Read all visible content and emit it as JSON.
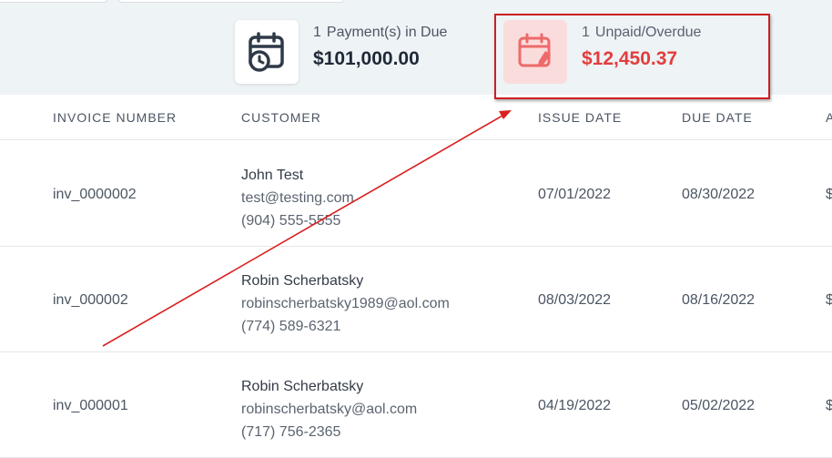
{
  "summary": {
    "due": {
      "count": "1",
      "label": "Payment(s) in Due",
      "amount": "$101,000.00",
      "icon": "calendar-clock-icon"
    },
    "overdue": {
      "count": "1",
      "label": "Unpaid/Overdue",
      "amount": "$12,450.37",
      "icon": "calendar-edit-icon",
      "accent": "#e23d3d"
    }
  },
  "table": {
    "headers": [
      "INVOICE NUMBER",
      "CUSTOMER",
      "ISSUE DATE",
      "DUE DATE",
      "A"
    ],
    "rows": [
      {
        "invoice": "inv_0000002",
        "name": "John Test",
        "email": "test@testing.com",
        "phone": "(904) 555-5555",
        "issue": "07/01/2022",
        "due": "08/30/2022",
        "amount_partial": "$"
      },
      {
        "invoice": "inv_000002",
        "name": "Robin Scherbatsky",
        "email": "robinscherbatsky1989@aol.com",
        "phone": "(774) 589-6321",
        "issue": "08/03/2022",
        "due": "08/16/2022",
        "amount_partial": "$"
      },
      {
        "invoice": "inv_000001",
        "name": "Robin Scherbatsky",
        "email": "robinscherbatsky@aol.com",
        "phone": "(717) 756-2365",
        "issue": "04/19/2022",
        "due": "05/02/2022",
        "amount_partial": "$"
      }
    ]
  },
  "annotation": {
    "color": "#cc1f1f"
  }
}
